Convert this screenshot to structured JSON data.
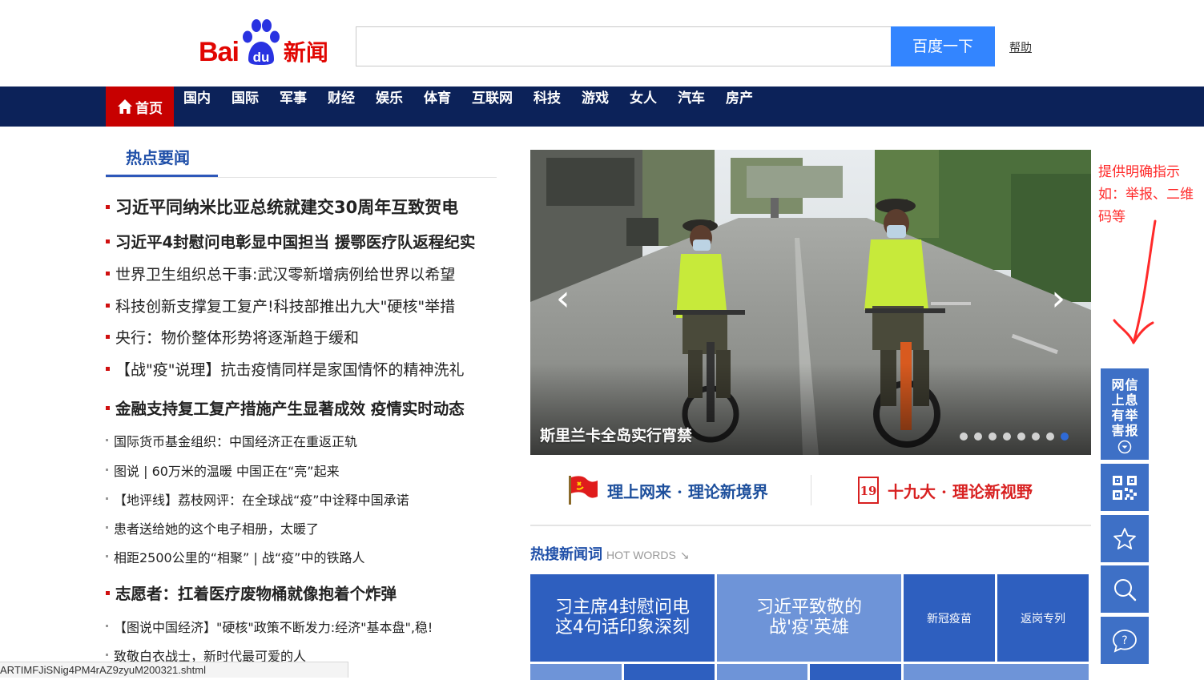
{
  "header": {
    "logo_bai": "Bai",
    "logo_du": "du",
    "logo_news": "新闻",
    "search_value": "",
    "search_button": "百度一下",
    "help": "帮助"
  },
  "nav": {
    "home": "首页",
    "items": [
      "国内",
      "国际",
      "军事",
      "财经",
      "娱乐",
      "体育",
      "互联网",
      "科技",
      "游戏",
      "女人",
      "汽车",
      "房产"
    ]
  },
  "left": {
    "section_title": "热点要闻",
    "news": [
      "习近平同纳米比亚总统就建交30周年互致贺电",
      "习近平4封慰问电彰显中国担当 援鄂医疗队返程纪实",
      "世界卫生组织总干事:武汉零新增病例给世界以希望",
      "科技创新支撑复工复产!科技部推出九大\"硬核\"举措",
      "央行：物价整体形势将逐渐趋于缓和",
      "【战\"疫\"说理】抗击疫情同样是家国情怀的精神洗礼",
      "金融支持复工复产措施产生显著成效 疫情实时动态",
      "国际货币基金组织：中国经济正在重返正轨",
      "图说 | 60万米的温暖 中国正在“亮”起来",
      "【地评线】荔枝网评：在全球战“疫”中诠释中国承诺",
      "患者送给她的这个电子相册，太暖了",
      "相距2500公里的“相聚” | 战“疫”中的铁路人",
      "志愿者：扛着医疗废物桶就像抱着个炸弹",
      "【图说中国经济】\"硬核\"政策不断发力:经济\"基本盘\",稳!",
      "致敬白衣战士，新时代最可爱的人"
    ]
  },
  "slideshow": {
    "caption": "斯里兰卡全岛实行宵禁",
    "prev": "‹",
    "next": "›",
    "total_slides": 8,
    "active_slide": 8
  },
  "banners": {
    "left": "理上网来 · 理论新境界",
    "right": "十九大 · 理论新视野",
    "right_badge": "19"
  },
  "hotwords": {
    "title": "热搜新闻词",
    "subtitle": "HOT WORDS",
    "tiles": [
      {
        "line1": "习主席4封慰问电",
        "line2": "这4句话印象深刻"
      },
      {
        "line1": "习近平致敬的",
        "line2": "战'疫'英雄"
      },
      {
        "text": "新冠疫苗"
      },
      {
        "text": "返岗专列"
      }
    ]
  },
  "annotation": {
    "text": "提供明确指示如：举报、二维码等"
  },
  "rail": {
    "report": [
      "网",
      "上",
      "有",
      "信",
      "息",
      "举"
    ],
    "report_last": "害报",
    "report_chars": [
      "网",
      "上",
      "有",
      "害",
      "信",
      "息",
      "举",
      "报"
    ]
  },
  "status_bar": "ARTIMFJiSNig4PM4rAZ9zyuM200321.shtml",
  "colors": {
    "nav_bg": "#0c2259",
    "home_bg": "#c70000",
    "accent_blue": "#3385ff",
    "tile_blue": "#2e5fbf",
    "tile_light": "#6e94d8",
    "rail_blue": "#3e70c6",
    "annotation_red": "#ff2a2a"
  }
}
